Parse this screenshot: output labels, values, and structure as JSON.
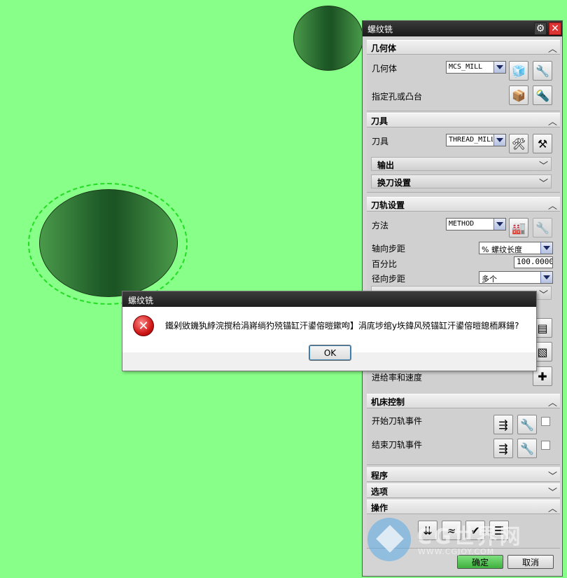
{
  "panel": {
    "title": "螺纹铣",
    "sections": {
      "geometry": {
        "header": "几何体",
        "geometry_label": "几何体",
        "geometry_value": "MCS_MILL",
        "hole_label": "指定孔或凸台"
      },
      "tool": {
        "header": "刀具",
        "tool_label": "刀具",
        "tool_value": "THREAD_MILL",
        "output_label": "输出",
        "toolchange_label": "换刀设置"
      },
      "path": {
        "header": "刀轨设置",
        "method_label": "方法",
        "method_value": "METHOD",
        "axial_step_label": "轴向步距",
        "axial_step_value": "% 螺纹长度",
        "percent_label": "百分比",
        "percent_value": "100.0000",
        "radial_step_label": "径向步距",
        "radial_step_value": "多个",
        "feeds_label": "进给率和速度"
      },
      "machine": {
        "header": "机床控制",
        "start_event_label": "开始刀轨事件",
        "end_event_label": "结束刀轨事件"
      },
      "program": {
        "header": "程序"
      },
      "options": {
        "header": "选项"
      },
      "actions": {
        "header": "操作"
      }
    },
    "ok_label": "确定",
    "cancel_label": "取消"
  },
  "watermark": {
    "text": "CG世界网",
    "url": "WWW.CGJOY.COM"
  },
  "dialog": {
    "title": "螺纹铣",
    "message": "鐵剁敓鐖犱綍浣撹秴涓嶈绱犳殑锚缸汗鍙傛暟鏉呴】涓庣埗绾у垁鍏风殑锚缸汗鍙傛暟鎴栭厤鍚?",
    "ok_label": "OK"
  }
}
